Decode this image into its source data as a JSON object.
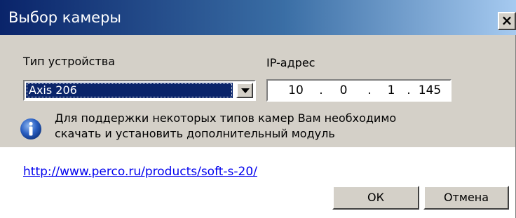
{
  "window": {
    "title": "Выбор камеры",
    "close_label": "×"
  },
  "device_type": {
    "label": "Тип устройства",
    "selected": "Axis 206"
  },
  "ip": {
    "label": "IP-адрес",
    "octets": [
      "10",
      "0",
      "1",
      "145"
    ],
    "separator": "."
  },
  "info": {
    "icon": "info-icon",
    "line1": "Для поддержки некоторых типов камер Вам необходимо",
    "line2": "скачать и установить дополнительный модуль"
  },
  "link": {
    "text": "http://www.perco.ru/products/soft-s-20/"
  },
  "buttons": {
    "ok": "ОК",
    "cancel": "Отмена"
  },
  "colors": {
    "title_start": "#0a246a",
    "title_end": "#a6caf0",
    "face": "#d4d0c8",
    "selection": "#0a246a",
    "link": "#0000ee"
  }
}
